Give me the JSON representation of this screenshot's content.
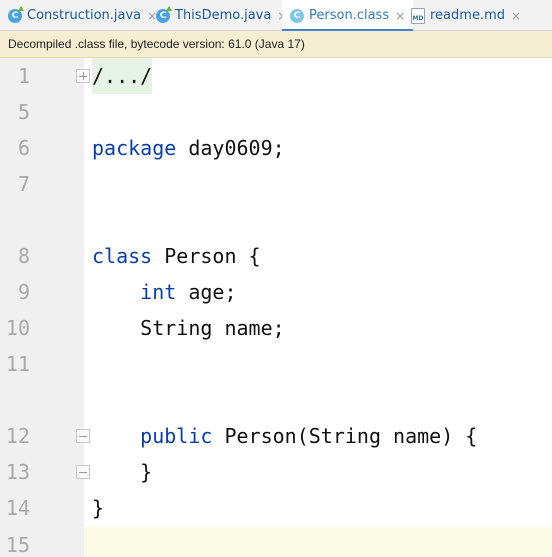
{
  "tabs": [
    {
      "label": "Construction.java",
      "icon": "java-class-icon",
      "active": false
    },
    {
      "label": "ThisDemo.java",
      "icon": "java-class-icon",
      "active": false
    },
    {
      "label": "Person.class",
      "icon": "class-file-icon",
      "active": true
    },
    {
      "label": "readme.md",
      "icon": "markdown-file-icon",
      "active": false
    }
  ],
  "tab_close_glyph": "×",
  "banner": {
    "text": "Decompiled .class file, bytecode version: 61.0 (Java 17)"
  },
  "editor": {
    "lines": [
      {
        "num": "1",
        "text": "/.../"
      },
      {
        "num": "5",
        "text": ""
      },
      {
        "num": "6",
        "keyword": "package",
        "rest": " day0609;"
      },
      {
        "num": "7",
        "text": ""
      },
      {
        "num": "8",
        "keyword": "class",
        "rest": " Person {"
      },
      {
        "num": "9",
        "indent": "    ",
        "keyword": "int",
        "rest": " age;"
      },
      {
        "num": "10",
        "text": "    String name;"
      },
      {
        "num": "11",
        "text": ""
      },
      {
        "num": "12",
        "indent": "    ",
        "keyword": "public",
        "rest": " Person(String name) {"
      },
      {
        "num": "13",
        "text": "    }"
      },
      {
        "num": "14",
        "text": "}"
      },
      {
        "num": "15",
        "text": ""
      }
    ]
  },
  "colors": {
    "keyword": "#0b3fa8",
    "active_tab_underline": "#4083c9",
    "banner_bg": "#f5eed2"
  }
}
